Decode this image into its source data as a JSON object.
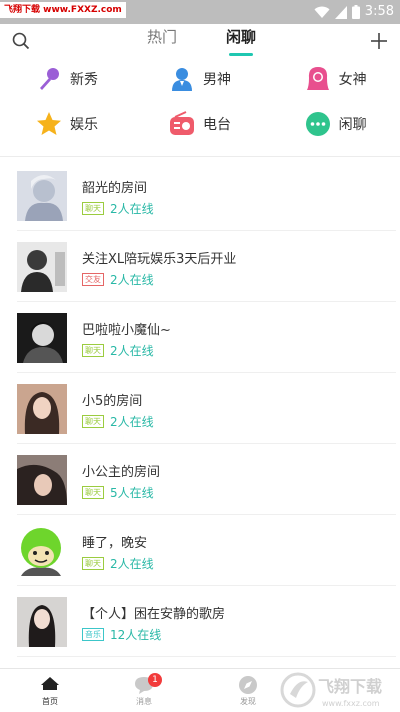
{
  "status_bar": {
    "watermark": "飞翔下载 www.FXXZ.com",
    "time": "3:58"
  },
  "header": {
    "tabs": [
      {
        "label": "热门"
      },
      {
        "label": "闲聊"
      }
    ],
    "active_tab": "闲聊",
    "accent_color": "#1fc7b1",
    "left_icon": "search-icon",
    "right_icon": "plus-icon"
  },
  "categories": [
    {
      "label": "新秀",
      "icon": "microphone-icon",
      "color": "#9b5fd6"
    },
    {
      "label": "男神",
      "icon": "man-icon",
      "color": "#3a8de0"
    },
    {
      "label": "女神",
      "icon": "woman-icon",
      "color": "#e84f8e"
    },
    {
      "label": "娱乐",
      "icon": "star-icon",
      "color": "#f6b21b"
    },
    {
      "label": "电台",
      "icon": "radio-icon",
      "color": "#ef5b6b"
    },
    {
      "label": "闲聊",
      "icon": "chat-bubble-icon",
      "color": "#2fc48d"
    }
  ],
  "rooms": [
    {
      "name": "韶光的房间",
      "tag": "聊天",
      "online": "2人在线"
    },
    {
      "name": "关注XL陪玩娱乐3天后开业",
      "tag": "交友",
      "online": "2人在线"
    },
    {
      "name": "巴啦啦小魔仙~",
      "tag": "聊天",
      "online": "2人在线"
    },
    {
      "name": "小5的房间",
      "tag": "聊天",
      "online": "2人在线"
    },
    {
      "name": "小公主的房间",
      "tag": "聊天",
      "online": "5人在线"
    },
    {
      "name": "睡了，晚安",
      "tag": "聊天",
      "online": "2人在线"
    },
    {
      "name": "【个人】困在安静的歌房",
      "tag": "音乐",
      "online": "12人在线"
    }
  ],
  "bottom_nav": [
    {
      "label": "首页",
      "icon": "home-icon"
    },
    {
      "label": "消息",
      "icon": "message-icon",
      "badge": "1"
    },
    {
      "label": "发现",
      "icon": "compass-icon"
    }
  ],
  "corner_logo": "飞翔下载 www.fxxz.com"
}
